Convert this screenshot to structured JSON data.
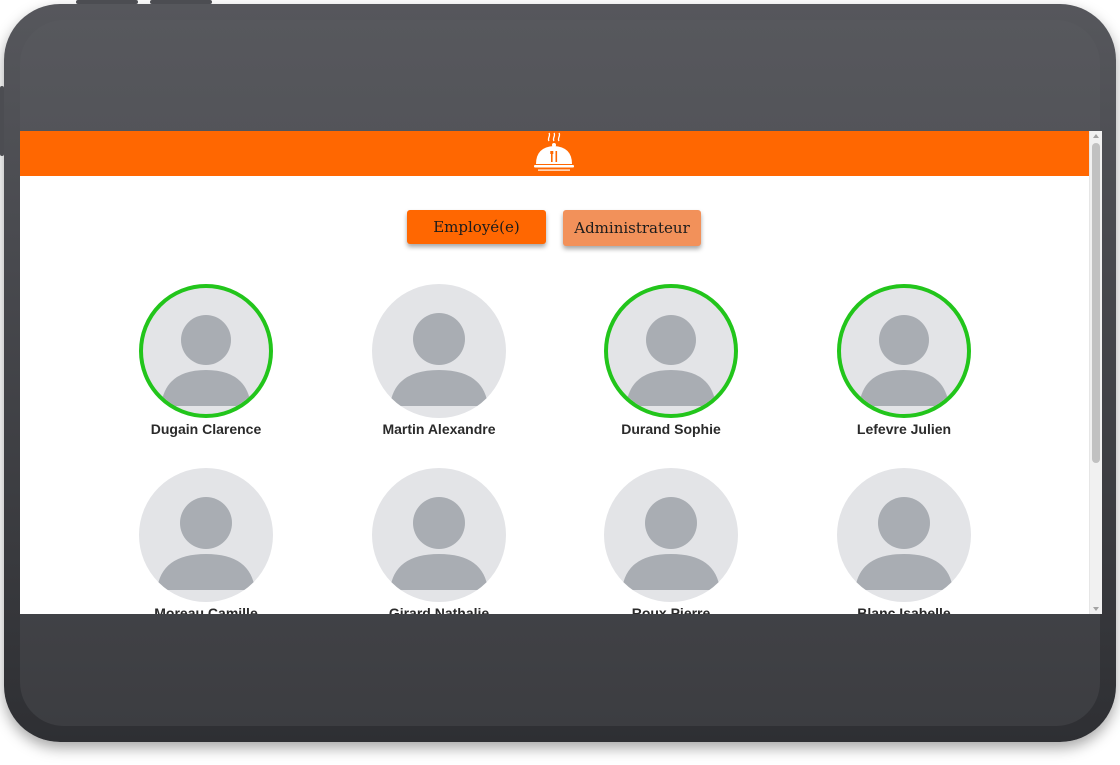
{
  "header": {
    "logo_icon": "restaurant-cloche-icon",
    "background_color": "#ff6701"
  },
  "role_tabs": {
    "employee_label": "Employé(e)",
    "admin_label": "Administrateur",
    "selected": "Employé(e)"
  },
  "profiles": [
    {
      "name": "Dugain Clarence",
      "active": true
    },
    {
      "name": "Martin Alexandre",
      "active": false
    },
    {
      "name": "Durand Sophie",
      "active": true
    },
    {
      "name": "Lefevre Julien",
      "active": true
    },
    {
      "name": "Moreau Camille",
      "active": false
    },
    {
      "name": "Girard Nathalie",
      "active": false
    },
    {
      "name": "Roux Pierre",
      "active": false
    },
    {
      "name": "Blanc Isabelle",
      "active": false
    }
  ],
  "colors": {
    "accent": "#ff6701",
    "admin_button": "#f2915a",
    "active_ring": "#22c51b",
    "avatar_bg": "#e3e4e7",
    "avatar_silhouette": "#a9adb3"
  }
}
